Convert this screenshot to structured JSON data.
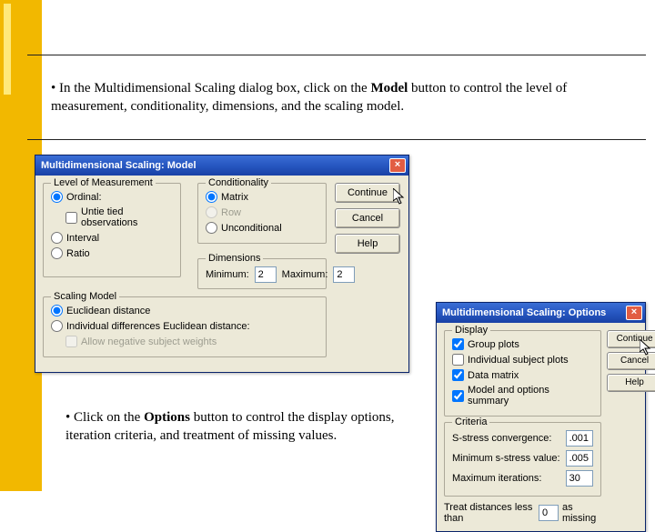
{
  "intro1": "• In the Multidimensional Scaling dialog box, click on the ",
  "intro1_bold": "Model",
  "intro1_tail": " button to control the level of measurement, conditionality, dimensions, and the scaling model.",
  "intro2": "• Click on the ",
  "intro2_bold": "Options",
  "intro2_tail": " button to control the display options, iteration criteria, and treatment of missing values.",
  "modelDialog": {
    "title": "Multidimensional Scaling: Model",
    "buttons": {
      "continue": "Continue",
      "cancel": "Cancel",
      "help": "Help"
    },
    "level": {
      "title": "Level of Measurement",
      "ordinal": "Ordinal:",
      "untie": "Untie tied observations",
      "interval": "Interval",
      "ratio": "Ratio"
    },
    "cond": {
      "title": "Conditionality",
      "matrix": "Matrix",
      "row": "Row",
      "uncond": "Unconditional"
    },
    "dims": {
      "title": "Dimensions",
      "min": "Minimum:",
      "minVal": "2",
      "max": "Maximum:",
      "maxVal": "2"
    },
    "scaling": {
      "title": "Scaling Model",
      "euclid": "Euclidean distance",
      "indscal": "Individual differences Euclidean distance:",
      "allowneg": "Allow negative subject weights"
    }
  },
  "optionsDialog": {
    "title": "Multidimensional Scaling: Options",
    "buttons": {
      "continue": "Continue",
      "cancel": "Cancel",
      "help": "Help"
    },
    "display": {
      "title": "Display",
      "group": "Group plots",
      "indiv": "Individual subject plots",
      "datam": "Data matrix",
      "summary": "Model and options summary"
    },
    "criteria": {
      "title": "Criteria",
      "sstress": "S-stress convergence:",
      "sstressVal": ".001",
      "minS": "Minimum s-stress value:",
      "minSVal": ".005",
      "maxIter": "Maximum iterations:",
      "maxIterVal": "30"
    },
    "missing": {
      "pre": "Treat distances less than",
      "val": "0",
      "post": "as missing"
    }
  }
}
